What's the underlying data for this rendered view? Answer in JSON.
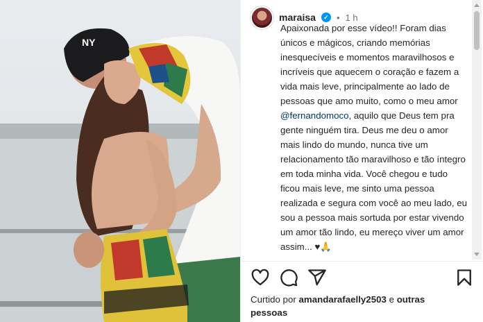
{
  "post": {
    "username": "maraisa",
    "verified_mark": "✓",
    "separator": "•",
    "time": "1 h",
    "caption_before_mention": "Apaixonada por esse vídeo!! Foram dias únicos e mágicos, criando memórias inesquecíveis e momentos maravilhosos e incríveis que aquecem o coração e fazem a vida mais leve, principalmente ao lado de pessoas que amo muito, como o meu amor ",
    "mention": "@fernandomoco",
    "caption_after_mention": ", aquilo que Deus tem pra gente ninguém tira. Deus me deu o amor mais lindo do mundo, nunca tive um relacionamento tão maravilhoso e tão íntegro em toda minha vida. Você chegou e tudo ficou mais leve, me sinto uma pessoa realizada e segura com você ao meu lado, eu sou a pessoa mais sortuda por estar vivendo um amor tão lindo, eu mereço viver um amor assim... ♥🙏"
  },
  "icons": {
    "like": "heart-icon",
    "comment": "comment-icon",
    "share": "share-icon",
    "save": "bookmark-icon",
    "verified": "verified-badge-icon",
    "scroll_up": "scroll-up-arrow-icon",
    "scroll_down": "scroll-down-arrow-icon"
  },
  "likes": {
    "prefix": "Curtido por ",
    "user": "amandarafaelly2503",
    "conjunction": " e ",
    "others": "outras pessoas"
  },
  "colors": {
    "verified": "#0095f6",
    "mention": "#00376b",
    "text": "#262626",
    "secondary": "#737373"
  }
}
